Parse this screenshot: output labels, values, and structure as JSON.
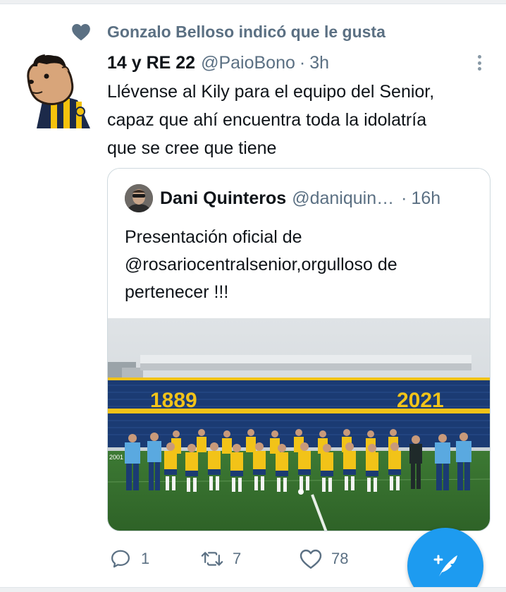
{
  "social_context": {
    "icon": "heart-filled-icon",
    "text": "Gonzalo Belloso indicó que le gusta"
  },
  "tweet": {
    "display_name": "14 y RE 22",
    "handle": "@PaioBono",
    "separator": "·",
    "time": "3h",
    "text_lines": [
      "Llévense al Kily para el equipo del Senior,",
      "capaz que ahí encuentra toda la idolatría",
      "que se cree que tiene"
    ],
    "avatar_icon": "capybara-avatar-icon",
    "more_icon": "more-vertical-icon"
  },
  "quoted_tweet": {
    "display_name": "Dani Quinteros",
    "handle": "@daniquin…",
    "separator": "·",
    "time": "16h",
    "text_lines": [
      "Presentación oficial de",
      "@rosariocentralsenior,orgulloso de",
      "pertenecer !!!"
    ],
    "photo": {
      "stand_text_left": "1889",
      "stand_text_right": "2021",
      "pitch_sign": "2001"
    }
  },
  "actions": {
    "reply_count": "1",
    "retweet_count": "7",
    "like_count": "78"
  },
  "fab": {
    "icon": "compose-feather-icon"
  },
  "colors": {
    "secondary_text": "#5b7083",
    "primary_text": "#0f1419",
    "accent": "#1d9bf0",
    "border": "#cfd9de"
  }
}
